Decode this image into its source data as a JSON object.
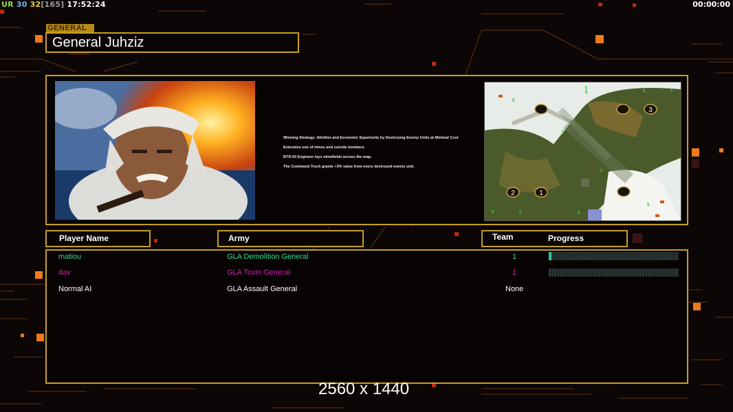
{
  "hud": {
    "ur_label": "UR",
    "ur_value": "30",
    "fps_value": "32",
    "fps_bracket": "[165]",
    "clock": "17:52:24",
    "game_timer": "00:00:00"
  },
  "general": {
    "tag": "GENERAL",
    "name": "General Juhziz",
    "strategy_lines": [
      "Winning Strategy: Attrition and Economic Superiority by Destroying Enemy Units at Minimal Cost",
      "Extensive use of mines and suicide bombers.",
      "BTR-50 Engineer lays minefields across the map.",
      "The Command Truck grants +3% value from every destroyed enemy unit."
    ]
  },
  "minimap": {
    "start_positions": [
      "3",
      "2",
      "1"
    ]
  },
  "table": {
    "headers": {
      "player_name": "Player Name",
      "army": "Army",
      "team": "Team",
      "progress": "Progress"
    },
    "rows": [
      {
        "name": "matiou",
        "army": "GLA Demolition General",
        "team": "1",
        "color": "#2ed89a",
        "progress": 0.02,
        "show_progress": true
      },
      {
        "name": "dav",
        "army": "GLA Toxin General",
        "team": "1",
        "color": "#d020b0",
        "progress": 0,
        "show_progress": true
      },
      {
        "name": "Normal AI",
        "army": "GLA Assault General",
        "team": "None",
        "color": "#ffffff",
        "show_progress": false
      }
    ]
  },
  "overlay": {
    "resolution": "2560 x 1440"
  },
  "colors": {
    "accent": "#c8a020",
    "background": "#0d0606",
    "ur_color": "#8ed84a",
    "fps_color": "#f0d040",
    "bracket_color": "#9a9a9a"
  }
}
